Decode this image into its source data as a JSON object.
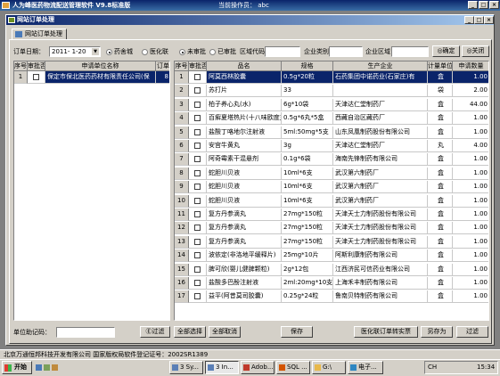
{
  "app": {
    "title": "人为峰医药物流配送管理软件 V9.8标准版",
    "user_info": "当前操作员： abc"
  },
  "child": {
    "title": "网站订单处理",
    "tab": "网站订单处理"
  },
  "filters": {
    "date_label": "订单日期：",
    "date_value": "2011- 1-20",
    "radio_pharma": "药舍城",
    "radio_medplat": "医化联",
    "radio_unreviewed": "未审批",
    "radio_reviewed": "已审批",
    "region_code_label": "区域代码",
    "company_type_label": "企业类别",
    "company_region_label": "企业区域",
    "confirm": "确定",
    "close": "关闭"
  },
  "left_grid": {
    "headers": [
      "序号",
      "审批否",
      "申请单位名称",
      "订单"
    ],
    "rows": [
      {
        "no": "1",
        "name": "保定市保北医药药材有限责任公司(保",
        "order": "8"
      }
    ]
  },
  "right_grid": {
    "headers": [
      "序号",
      "审批否",
      "品名",
      "规格",
      "生产企业",
      "计量单位",
      "申请数量"
    ],
    "rows": [
      {
        "no": "1",
        "name": "阿莫西林胶囊",
        "spec": "0.5g*20粒",
        "maker": "石药集团中诺药业(石家庄)有",
        "unit": "盒",
        "qty": "1.00"
      },
      {
        "no": "2",
        "name": "苏打片",
        "spec": "33",
        "maker": "",
        "unit": "袋",
        "qty": "2.00"
      },
      {
        "no": "3",
        "name": "柏子养心丸(水)",
        "spec": "6g*10袋",
        "maker": "天津达仁堂制药厂",
        "unit": "盒",
        "qty": "44.00"
      },
      {
        "no": "4",
        "name": "百癣夏塔热片(十八味欧度丸+胶囊)",
        "spec": "0.5g*6丸*5盒",
        "maker": "西藏自治区藏药厂",
        "unit": "盒",
        "qty": "1.00"
      },
      {
        "no": "5",
        "name": "盐酸丁咯地尔注射液",
        "spec": "5ml:50mg*5支",
        "maker": "山东凤凰制药股份有限公司",
        "unit": "盒",
        "qty": "1.00"
      },
      {
        "no": "6",
        "name": "安宫牛黄丸",
        "spec": "3g",
        "maker": "天津达仁堂制药厂",
        "unit": "丸",
        "qty": "4.00"
      },
      {
        "no": "7",
        "name": "阿奇霉素干混悬剂",
        "spec": "0.1g*6袋",
        "maker": "海南先锋制药有限公司",
        "unit": "盒",
        "qty": "1.00"
      },
      {
        "no": "8",
        "name": "蛇胆川贝液",
        "spec": "10ml*6支",
        "maker": "武汉第六制药厂",
        "unit": "盒",
        "qty": "1.00"
      },
      {
        "no": "9",
        "name": "蛇胆川贝液",
        "spec": "10ml*6支",
        "maker": "武汉第六制药厂",
        "unit": "盒",
        "qty": "1.00"
      },
      {
        "no": "10",
        "name": "蛇胆川贝液",
        "spec": "10ml*6支",
        "maker": "武汉第六制药厂",
        "unit": "盒",
        "qty": "1.00"
      },
      {
        "no": "11",
        "name": "复方丹参滴丸",
        "spec": "27mg*150粒",
        "maker": "天津天士力制药股份有限公司",
        "unit": "盒",
        "qty": "1.00"
      },
      {
        "no": "12",
        "name": "复方丹参滴丸",
        "spec": "27mg*150粒",
        "maker": "天津天士力制药股份有限公司",
        "unit": "盒",
        "qty": "1.00"
      },
      {
        "no": "13",
        "name": "复方丹参滴丸",
        "spec": "27mg*150粒",
        "maker": "天津天士力制药股份有限公司",
        "unit": "盒",
        "qty": "1.00"
      },
      {
        "no": "14",
        "name": "波依定(非洛地平缓释片)",
        "spec": "25mg*10片",
        "maker": "阿斯利康制药有限公司",
        "unit": "盒",
        "qty": "1.00"
      },
      {
        "no": "15",
        "name": "脾可欣(婴儿健脾颗粒)",
        "spec": "2g*12包",
        "maker": "江西济民可信药业有限公司",
        "unit": "盒",
        "qty": "1.00"
      },
      {
        "no": "16",
        "name": "盐酸多巴酚注射液",
        "spec": "2ml:20mg*10支",
        "maker": "上海禾丰制药有限公司",
        "unit": "盒",
        "qty": "1.00"
      },
      {
        "no": "17",
        "name": "益平(阿昔莫司胶囊)",
        "spec": "0.25g*24粒",
        "maker": "鲁南贝特制药有限公司",
        "unit": "盒",
        "qty": "1.00"
      }
    ]
  },
  "bottom": {
    "unit_code_label": "单位助记码：",
    "filter_left": "过滤",
    "select_all": "全部选择",
    "cancel_all": "全部取消",
    "save": "保存",
    "approve": "医化联订单转实票",
    "save_as": "另存为",
    "filter_right": "过滤"
  },
  "statusbar": "北京万通恒邦科技开发有限公司 国家版权局软件登记证号：2002SR1389",
  "taskbar": {
    "start": "开始",
    "tasks": [
      "",
      "3 Sy...",
      "3 In...",
      "Adob...",
      "SQL ...",
      "G:\\",
      "电子..."
    ],
    "tray_text": "CH",
    "clock": "15:34"
  },
  "colors": {
    "title_dark": "#0a246a",
    "title_light": "#3a6ea5",
    "selected_row": "#0a246a"
  }
}
